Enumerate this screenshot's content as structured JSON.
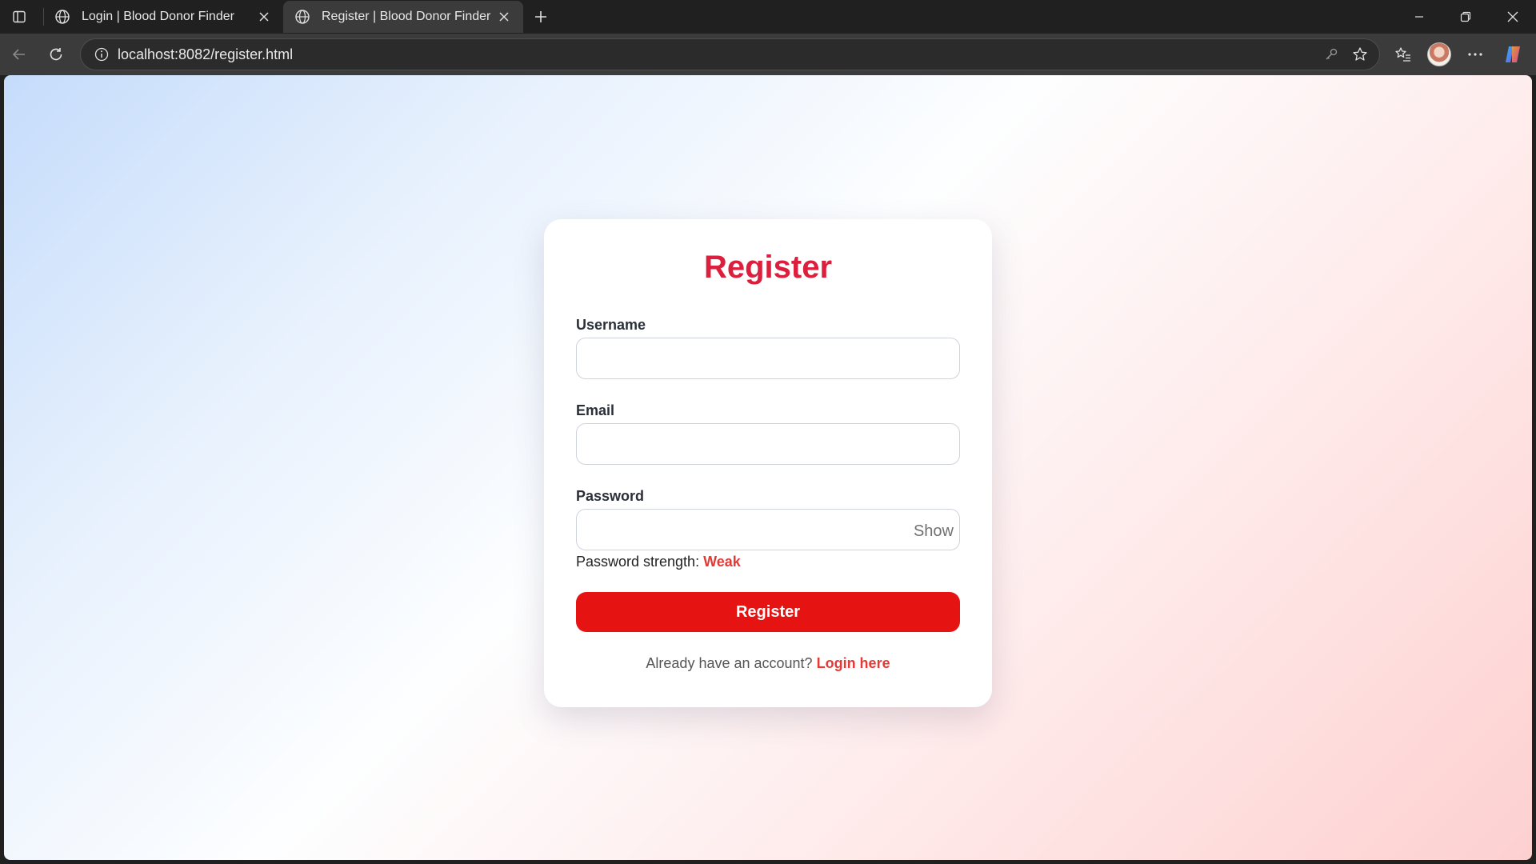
{
  "browser": {
    "tabs": [
      {
        "title": "Login | Blood Donor Finder",
        "active": false
      },
      {
        "title": "Register | Blood Donor Finder",
        "active": true
      }
    ],
    "address_bar": {
      "url": "localhost:8082/register.html"
    },
    "accent": "#3b3b3b"
  },
  "page": {
    "title": "Register",
    "fields": {
      "username": {
        "label": "Username",
        "value": "",
        "placeholder": ""
      },
      "email": {
        "label": "Email",
        "value": "",
        "placeholder": ""
      },
      "password": {
        "label": "Password",
        "value": "",
        "placeholder": "",
        "toggle_label": "Show"
      }
    },
    "strength": {
      "label": "Password strength:",
      "value": "Weak"
    },
    "submit_label": "Register",
    "login_prompt": {
      "text": "Already have an account?",
      "link": "Login here"
    },
    "colors": {
      "title": "#db1f3c",
      "button": "#e61313",
      "link": "#e53935"
    }
  }
}
